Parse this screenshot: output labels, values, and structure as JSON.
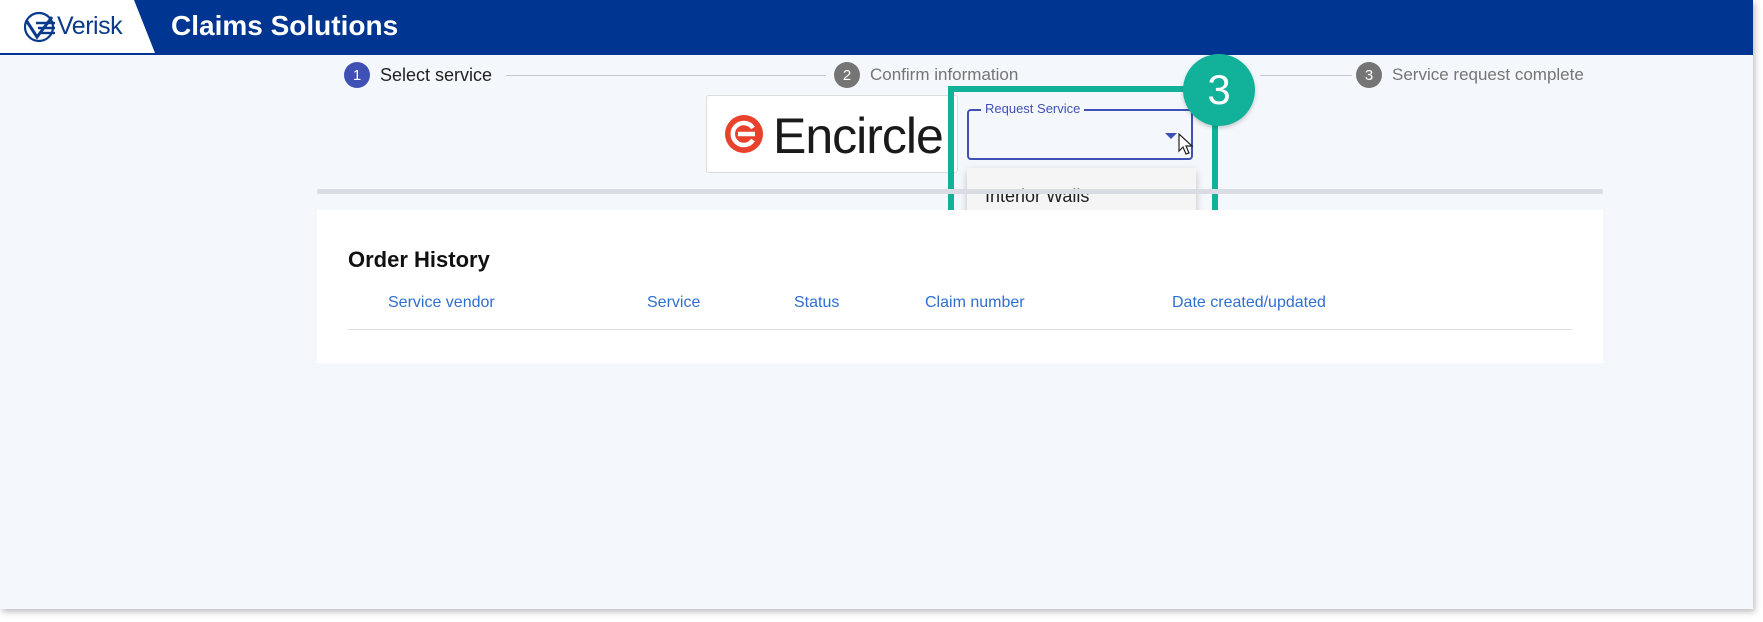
{
  "header": {
    "logo_text": "Verisk",
    "app_title": "Claims Solutions"
  },
  "stepper": {
    "steps": [
      {
        "number": "1",
        "label": "Select service",
        "state": "active"
      },
      {
        "number": "2",
        "label": "Confirm information",
        "state": "inactive"
      },
      {
        "number": "3",
        "label": "Service request complete",
        "state": "inactive"
      }
    ]
  },
  "vendor": {
    "name": "Encircle",
    "brand_color": "#e8412c"
  },
  "request_service": {
    "label": "Request Service",
    "value": "",
    "options": [
      "Interior Walls"
    ]
  },
  "annotation": {
    "badge_number": "3",
    "color": "#12b29a"
  },
  "order_history": {
    "title": "Order History",
    "columns": [
      "Service vendor",
      "Service",
      "Status",
      "Claim number",
      "Date created/updated"
    ],
    "rows": []
  },
  "colors": {
    "header_bg": "#003591",
    "primary": "#3f51b5",
    "link": "#2f6fd0"
  }
}
